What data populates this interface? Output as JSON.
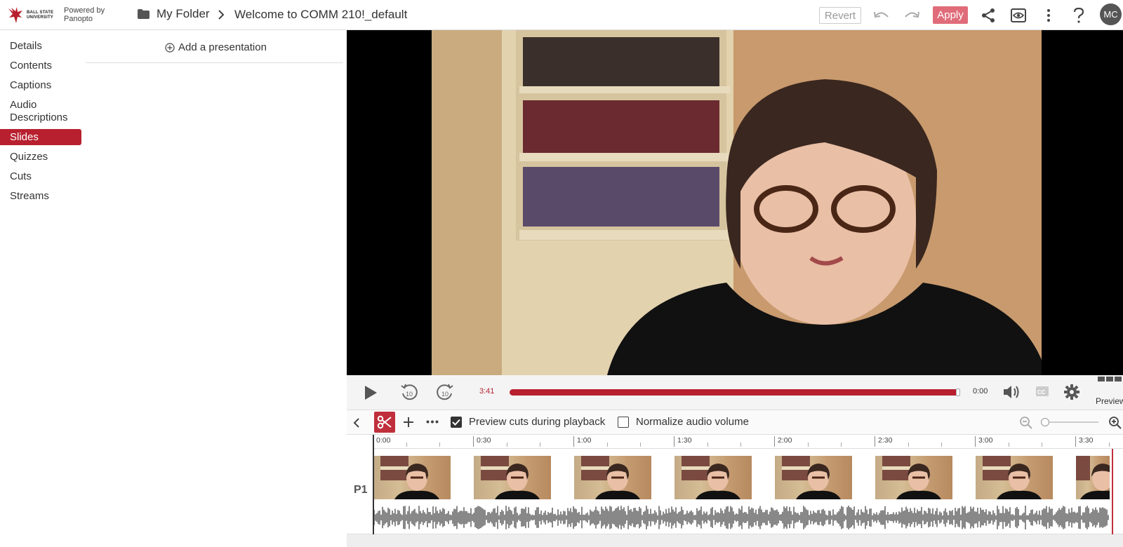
{
  "header": {
    "logo_text": "BALL STATE UNIVERSITY",
    "powered_by": "Powered by",
    "powered_by_name": "Panopto",
    "breadcrumb_folder": "My Folder",
    "session_title": "Welcome to COMM 210!_default",
    "revert_label": "Revert",
    "apply_label": "Apply",
    "avatar_initials": "MC"
  },
  "sidebar": {
    "items": [
      {
        "label": "Details",
        "active": false
      },
      {
        "label": "Contents",
        "active": false
      },
      {
        "label": "Captions",
        "active": false
      },
      {
        "label": "Audio Descriptions",
        "active": false
      },
      {
        "label": "Slides",
        "active": true
      },
      {
        "label": "Quizzes",
        "active": false
      },
      {
        "label": "Cuts",
        "active": false
      },
      {
        "label": "Streams",
        "active": false
      }
    ]
  },
  "slides_panel": {
    "add_presentation_label": "Add a presentation"
  },
  "player": {
    "current_time": "3:41",
    "end_time": "0:00",
    "progress": 1.0,
    "preview_label": "Preview"
  },
  "edit_toolbar": {
    "preview_cuts_label": "Preview cuts during playback",
    "preview_cuts_checked": true,
    "normalize_audio_label": "Normalize audio volume",
    "normalize_audio_checked": false,
    "zoom_level": 0.0
  },
  "timeline": {
    "ticks": [
      "0:00",
      "0:30",
      "1:00",
      "1:30",
      "2:00",
      "2:30",
      "3:00",
      "3:30"
    ],
    "track_label": "P1"
  },
  "colors": {
    "accent": "#b8202f",
    "apply_button": "#e06c7a"
  }
}
